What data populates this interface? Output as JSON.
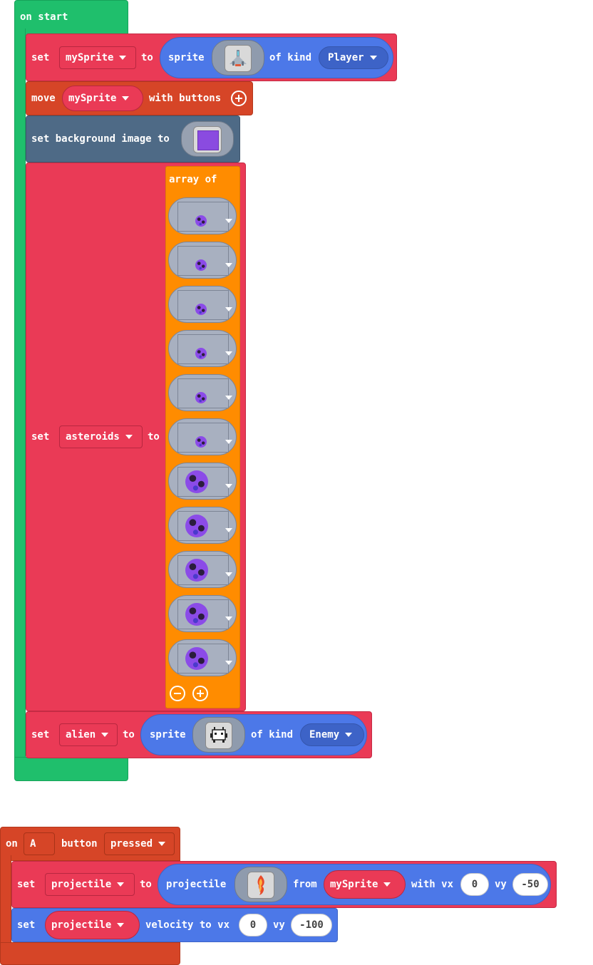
{
  "on_start": {
    "hat_label": "on start",
    "set_player": {
      "set": "set",
      "var": "mySprite",
      "to": "to",
      "sprite": "sprite",
      "of_kind": "of kind",
      "kind": "Player"
    },
    "move": {
      "move": "move",
      "var": "mySprite",
      "with_buttons": "with buttons"
    },
    "background": {
      "label": "set background image to",
      "color": "#8a4be0"
    },
    "set_asteroids": {
      "set": "set",
      "var": "asteroids",
      "to": "to",
      "array_of": "array of",
      "items": [
        {
          "icon": "asteroid-small-icon"
        },
        {
          "icon": "asteroid-small-icon"
        },
        {
          "icon": "asteroid-small-icon"
        },
        {
          "icon": "asteroid-small-icon"
        },
        {
          "icon": "asteroid-small-icon"
        },
        {
          "icon": "asteroid-small-icon"
        },
        {
          "icon": "asteroid-large-icon"
        },
        {
          "icon": "asteroid-large-icon"
        },
        {
          "icon": "asteroid-large-icon"
        },
        {
          "icon": "asteroid-large-icon"
        },
        {
          "icon": "asteroid-large-icon"
        }
      ]
    },
    "set_alien": {
      "set": "set",
      "var": "alien",
      "to": "to",
      "sprite": "sprite",
      "of_kind": "of kind",
      "kind": "Enemy"
    }
  },
  "on_button": {
    "on": "on",
    "button": "A",
    "button_label": "button",
    "event": "pressed",
    "set_projectile": {
      "set": "set",
      "var": "projectile",
      "to": "to",
      "projectile": "projectile",
      "from": "from",
      "source": "mySprite",
      "with_vx": "with vx",
      "vx": "0",
      "vy_label": "vy",
      "vy": "-50"
    },
    "set_velocity": {
      "set": "set",
      "var": "projectile",
      "velocity_to_vx": "velocity to vx",
      "vx": "0",
      "vy_label": "vy",
      "vy": "-100"
    }
  },
  "colors": {
    "green": "#1fbf6c",
    "red": "#ea3a56",
    "orange_red": "#d64527",
    "slate": "#4e6a86",
    "orange": "#ff8c00",
    "blue": "#4c78e8"
  }
}
